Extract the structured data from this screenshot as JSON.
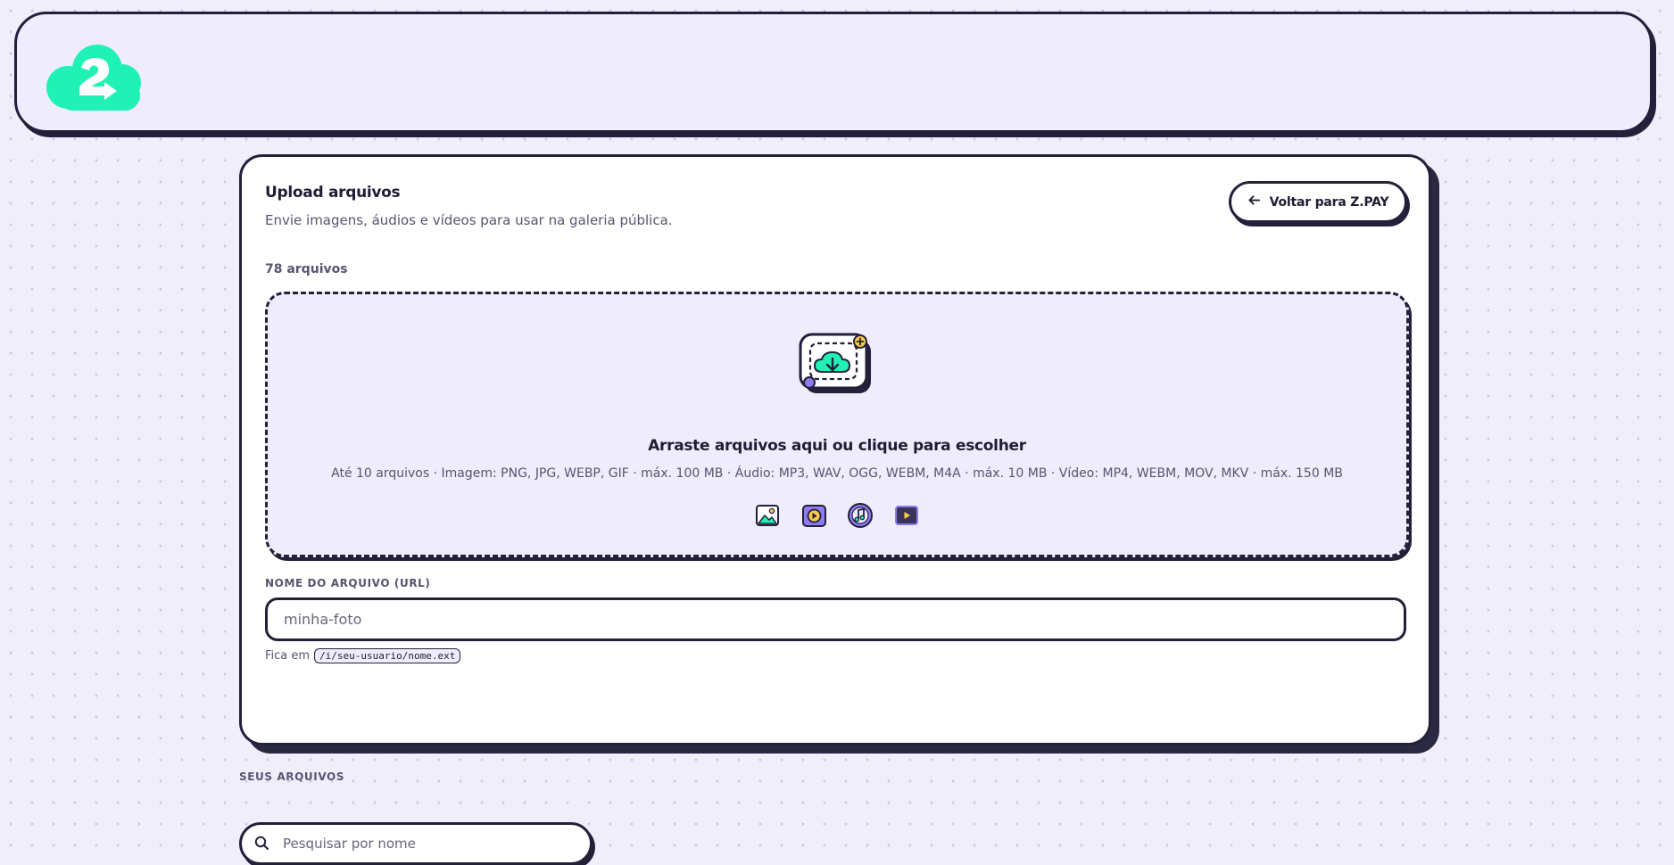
{
  "colors": {
    "brand_green": "#1ff2b4",
    "ink": "#23203a",
    "lavender": "#efecfe",
    "purple": "#8f7bf3",
    "yellow": "#f7c948"
  },
  "header": {
    "logo_icon": "zpay-cloud-logo-icon"
  },
  "upload": {
    "title": "Upload arquivos",
    "subtitle": "Envie imagens, áudios e vídeos para usar na galeria pública.",
    "back_label": "Voltar para Z.PAY",
    "back_icon": "arrow-left-icon",
    "file_count": "78 arquivos",
    "dropzone": {
      "illustration": "cloud-upload-icon",
      "title": "Arraste arquivos aqui ou clique para escolher",
      "limits": "Até 10 arquivos · Imagem: PNG, JPG, WEBP, GIF · máx. 100 MB · Áudio: MP3, WAV, OGG, WEBM, M4A · máx. 10 MB · Vídeo: MP4, WEBM, MOV, MKV · máx. 150 MB",
      "type_icons": [
        "image-icon",
        "media-play-icon",
        "music-note-icon",
        "video-icon"
      ]
    },
    "filename": {
      "label": "NOME DO ARQUIVO (URL)",
      "placeholder": "minha-foto",
      "hint_prefix": "Fica em",
      "hint_path": "/i/seu-usuario/nome.ext"
    }
  },
  "files": {
    "section_label": "SEUS ARQUIVOS",
    "search_icon": "search-icon",
    "search_placeholder": "Pesquisar por nome"
  }
}
